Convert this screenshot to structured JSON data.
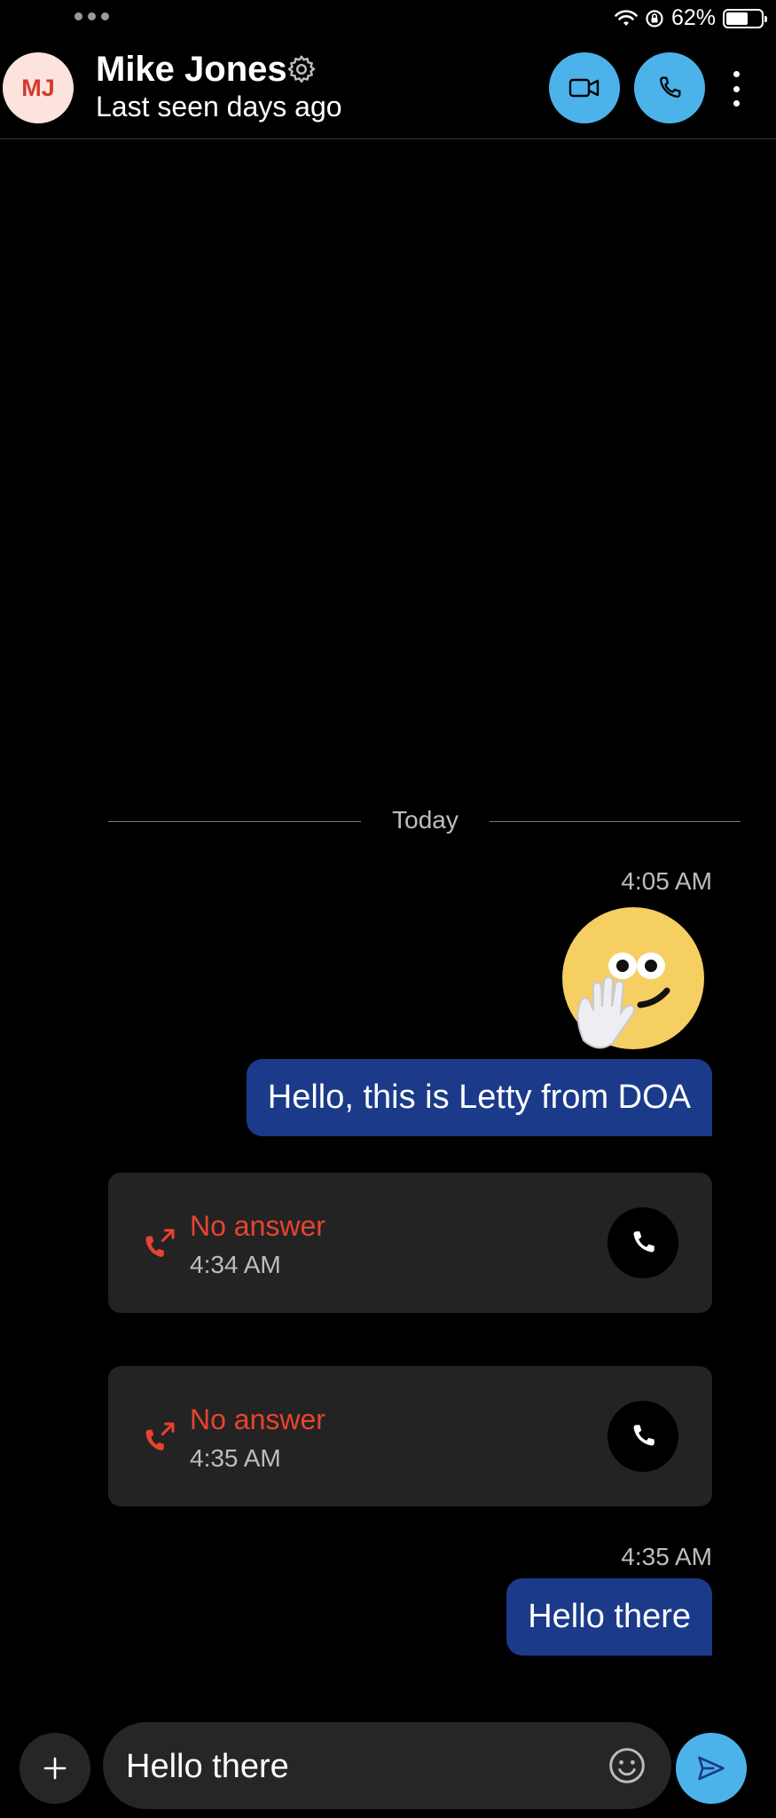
{
  "status_bar": {
    "battery_text": "62%",
    "battery_level": 0.62,
    "icons": [
      "wifi-icon",
      "orientation-lock-icon",
      "battery-icon"
    ]
  },
  "header": {
    "avatar_initials": "MJ",
    "contact_name": "Mike Jones",
    "last_seen": "Last seen days ago",
    "icons": [
      "gear-icon",
      "video-camera-icon",
      "phone-icon",
      "more-vertical-icon"
    ]
  },
  "conversation": {
    "date_separator": "Today",
    "messages": [
      {
        "type": "timestamp",
        "text": "4:05 AM"
      },
      {
        "type": "sticker",
        "icon": "wave-hand-emoji-sticker"
      },
      {
        "type": "text",
        "text": "Hello, this is Letty from DOA"
      },
      {
        "type": "call",
        "status": "No answer",
        "time": "4:34 AM"
      },
      {
        "type": "call",
        "status": "No answer",
        "time": "4:35 AM"
      },
      {
        "type": "timestamp",
        "text": "4:35 AM"
      },
      {
        "type": "text",
        "text": "Hello there"
      }
    ]
  },
  "composer": {
    "input_value": "Hello there",
    "icons": [
      "plus-icon",
      "emoji-icon",
      "send-icon"
    ]
  },
  "colors": {
    "accent": "#4cb3ea",
    "outgoing_bubble": "#1b3a8a",
    "missed_call": "#e8432f",
    "avatar_bg": "#fce3de",
    "avatar_text": "#d33b2c"
  }
}
